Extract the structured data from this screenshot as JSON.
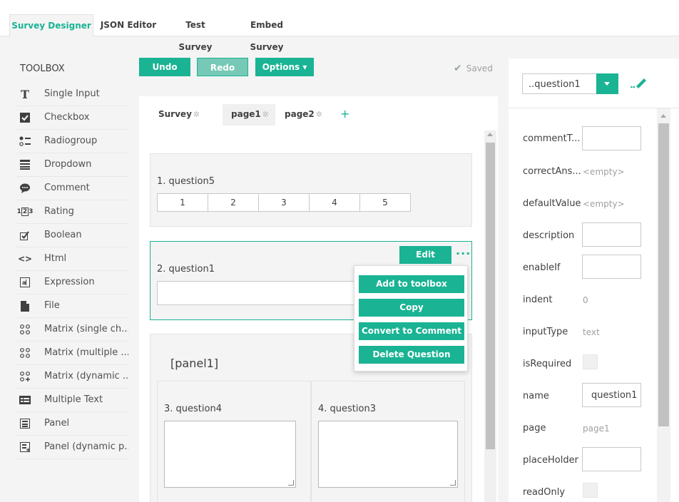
{
  "top_tabs": [
    {
      "label": "Survey Designer",
      "active": true
    },
    {
      "label": "JSON Editor",
      "active": false
    },
    {
      "label": "Test Survey",
      "active": false
    },
    {
      "label": "Embed Survey",
      "active": false
    }
  ],
  "toolbox": {
    "title": "TOOLBOX",
    "items": [
      {
        "label": "Single Input",
        "icon": "text-input-icon"
      },
      {
        "label": "Checkbox",
        "icon": "checkbox-icon"
      },
      {
        "label": "Radiogroup",
        "icon": "radiogroup-icon"
      },
      {
        "label": "Dropdown",
        "icon": "dropdown-icon"
      },
      {
        "label": "Comment",
        "icon": "comment-icon"
      },
      {
        "label": "Rating",
        "icon": "rating-icon"
      },
      {
        "label": "Boolean",
        "icon": "boolean-icon"
      },
      {
        "label": "Html",
        "icon": "html-icon"
      },
      {
        "label": "Expression",
        "icon": "expression-icon"
      },
      {
        "label": "File",
        "icon": "file-icon"
      },
      {
        "label": "Matrix (single ch...",
        "icon": "matrix-icon"
      },
      {
        "label": "Matrix (multiple ...",
        "icon": "matrix-icon"
      },
      {
        "label": "Matrix (dynamic ...",
        "icon": "matrix-dynamic-icon"
      },
      {
        "label": "Multiple Text",
        "icon": "multiple-text-icon"
      },
      {
        "label": "Panel",
        "icon": "panel-icon"
      },
      {
        "label": "Panel (dynamic p...",
        "icon": "panel-dynamic-icon"
      }
    ]
  },
  "toolbar": {
    "undo_label": "Undo",
    "redo_label": "Redo",
    "options_label": "Options ▾",
    "saved_label": "Saved"
  },
  "page_tabs": [
    {
      "label": "Survey",
      "active": false
    },
    {
      "label": "page1",
      "active": true
    },
    {
      "label": "page2",
      "active": false
    }
  ],
  "add_page_label": "+",
  "questions": {
    "q5": {
      "title": "1. question5",
      "rating_values": [
        "1",
        "2",
        "3",
        "4",
        "5"
      ]
    },
    "q1": {
      "title": "2. question1",
      "edit_label": "Edit",
      "more_label": "···"
    },
    "panel": {
      "title": "[panel1]"
    },
    "q4": {
      "title": "3. question4"
    },
    "q3": {
      "title": "4. question3"
    }
  },
  "context_menu": [
    "Add to toolbox",
    "Copy",
    "Convert to Comment",
    "Delete Question"
  ],
  "properties": {
    "selected_object": "..question1",
    "rows": [
      {
        "label": "commentT...",
        "kind": "input",
        "value": ""
      },
      {
        "label": "correctAns...",
        "kind": "text",
        "value": "<empty>"
      },
      {
        "label": "defaultValue",
        "kind": "text",
        "value": "<empty>"
      },
      {
        "label": "description",
        "kind": "input",
        "value": ""
      },
      {
        "label": "enableIf",
        "kind": "input",
        "value": ""
      },
      {
        "label": "indent",
        "kind": "text",
        "value": "0"
      },
      {
        "label": "inputType",
        "kind": "text",
        "value": "text"
      },
      {
        "label": "isRequired",
        "kind": "check",
        "value": ""
      },
      {
        "label": "name",
        "kind": "input",
        "value": "question1"
      },
      {
        "label": "page",
        "kind": "text",
        "value": "page1"
      },
      {
        "label": "placeHolder",
        "kind": "input",
        "value": ""
      },
      {
        "label": "readOnly",
        "kind": "check",
        "value": ""
      }
    ]
  },
  "colors": {
    "accent": "#1ab394",
    "background": "#f4f4f4"
  }
}
